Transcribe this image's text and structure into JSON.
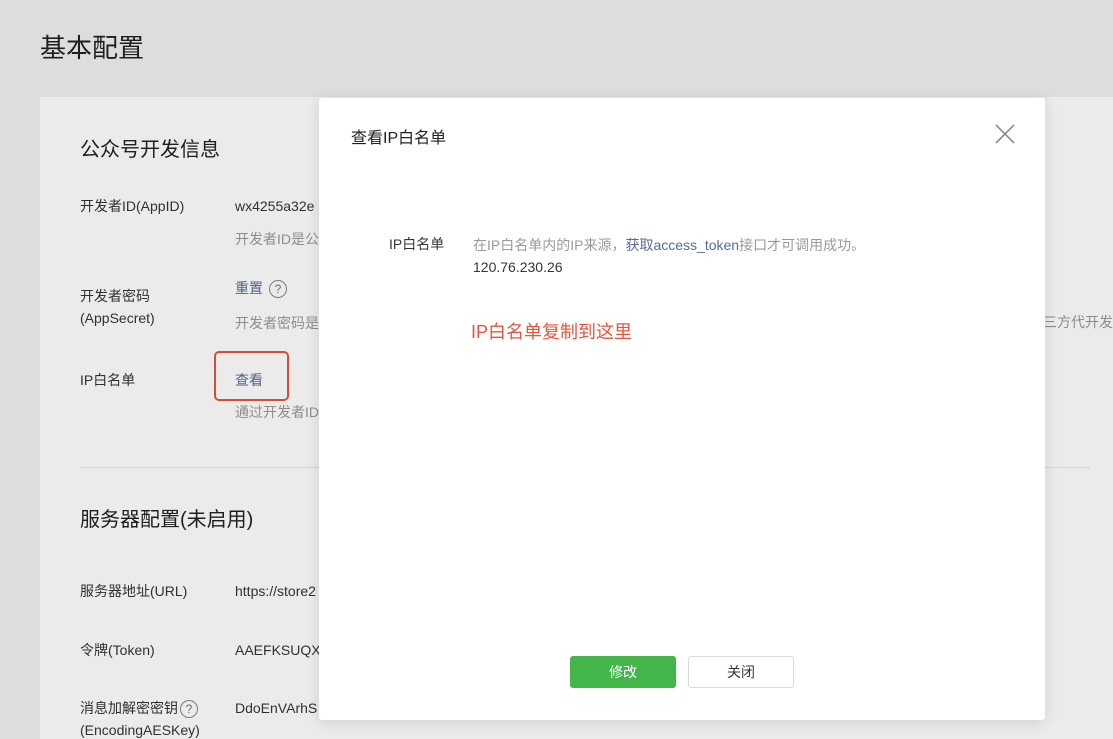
{
  "page": {
    "title": "基本配置"
  },
  "dev_info": {
    "section_title": "公众号开发信息",
    "appid_label": "开发者ID(AppID)",
    "appid_value": "wx4255a32e",
    "appid_desc": "开发者ID是公",
    "secret_label_line1": "开发者密码",
    "secret_label_line2": "(AppSecret)",
    "secret_reset": "重置",
    "secret_desc": "开发者密码是",
    "secret_desc_right": "三方代开发",
    "ip_label": "IP白名单",
    "ip_view": "查看",
    "ip_desc": "通过开发者ID"
  },
  "server": {
    "section_title": "服务器配置(未启用)",
    "url_label": "服务器地址(URL)",
    "url_value": "https://store2",
    "token_label": "令牌(Token)",
    "token_value": "AAEFKSUQX",
    "aes_label_line1": "消息加解密密钥",
    "aes_label_line2": "(EncodingAESKey)",
    "aes_value": "DdoEnVArhS"
  },
  "dialog": {
    "title": "查看IP白名单",
    "label": "IP白名单",
    "desc_prefix": "在IP白名单内的IP来源，",
    "desc_link": "获取access_token",
    "desc_suffix": "接口才可调用成功。",
    "ip": "120.76.230.26",
    "note": "IP白名单复制到这里",
    "modify_button": "修改",
    "close_button": "关闭"
  },
  "icons": {
    "help": "?"
  },
  "colors": {
    "primary": "#44b549",
    "link": "#576b95",
    "annotation": "#e8543c"
  }
}
